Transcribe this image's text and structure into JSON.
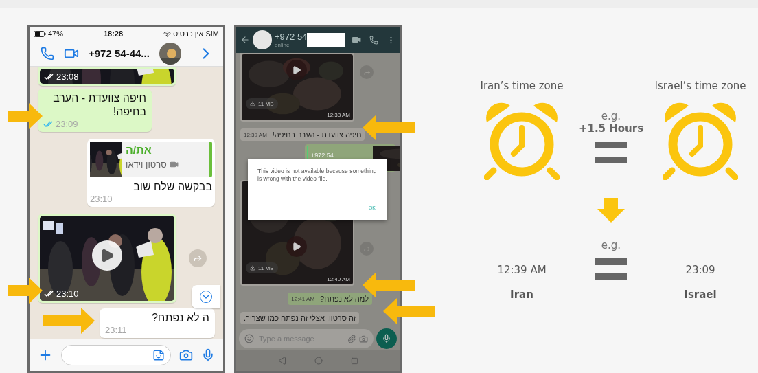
{
  "ios_chat": {
    "status_bar": {
      "battery": "47%",
      "time": "18:28",
      "carrier": "אין כרטיס SIM"
    },
    "contact": "+972 54-44...",
    "messages": [
      {
        "kind": "video",
        "outgoing": true,
        "time": "23:08",
        "partial": true
      },
      {
        "kind": "text",
        "outgoing": true,
        "text": "חיפה צוועדת - הערב בחיפה!",
        "time": "23:09"
      },
      {
        "kind": "reply",
        "outgoing": false,
        "quote_author": "את/ה",
        "quote_text": "סרטון וידאו",
        "text": "בבקשה שלח שוב",
        "time": "23:10"
      },
      {
        "kind": "video",
        "outgoing": true,
        "time": "23:10"
      },
      {
        "kind": "text",
        "outgoing": false,
        "text": "ה לא נפתח?",
        "time": "23:11"
      }
    ]
  },
  "android_chat": {
    "contact": "+972 54",
    "status": "online",
    "messages": [
      {
        "kind": "video",
        "outgoing": false,
        "size": "11 MB",
        "time": "12:38 AM"
      },
      {
        "kind": "text",
        "outgoing": false,
        "text": "חיפה צוועדת - הערב בחיפה!",
        "time": "12:39 AM"
      },
      {
        "kind": "reply",
        "outgoing": true,
        "quote_author": "+972 54"
      },
      {
        "kind": "video",
        "outgoing": false,
        "size": "11 MB",
        "time": "12:40 AM"
      },
      {
        "kind": "text",
        "outgoing": true,
        "text": "למה לא נפתח?",
        "time": "12:41 AM"
      },
      {
        "kind": "text",
        "outgoing": false,
        "text": "זה סרטוו. אצלי זה נפתח כמו שצריר."
      }
    ],
    "placeholder": "Type a message",
    "dialog": {
      "message": "This video is not available because something is wrong with the video file.",
      "button": "OK"
    }
  },
  "diagram": {
    "left_label": "Iran’s time zone",
    "right_label": "Israel’s time zone",
    "offset_prefix": "e.g.",
    "offset": "+1.5 Hours",
    "example_prefix": "e.g.",
    "left_time": "12:39 AM",
    "right_time": "23:09",
    "left_name": "Iran",
    "right_name": "Israel"
  }
}
